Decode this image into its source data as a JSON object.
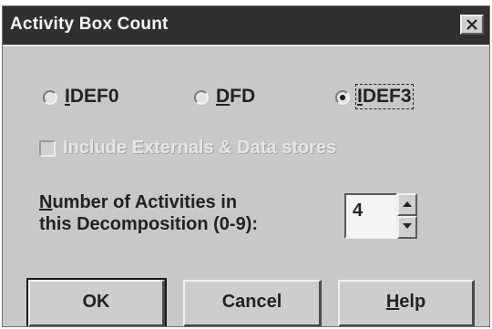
{
  "window": {
    "title": "Activity Box Count",
    "close_icon": "close-x-icon"
  },
  "methodology": {
    "options": [
      {
        "prefix": "",
        "mnemonic": "I",
        "suffix": "DEF0",
        "checked": false
      },
      {
        "prefix": "",
        "mnemonic": "D",
        "suffix": "FD",
        "checked": false
      },
      {
        "prefix": "",
        "mnemonic": "I",
        "suffix": "DEF3",
        "checked": true
      }
    ]
  },
  "externals_checkbox": {
    "label": "Include Externals & Data stores",
    "checked": false,
    "enabled": false
  },
  "activity_count": {
    "label_mnemonic": "N",
    "label_line1_rest": "umber of Activities in",
    "label_line2": "this Decomposition (0-9):",
    "value": "4",
    "up_icon": "arrow-up-icon",
    "down_icon": "arrow-down-icon"
  },
  "buttons": {
    "ok": "OK",
    "cancel": "Cancel",
    "help_mnemonic": "H",
    "help_rest": "elp"
  }
}
